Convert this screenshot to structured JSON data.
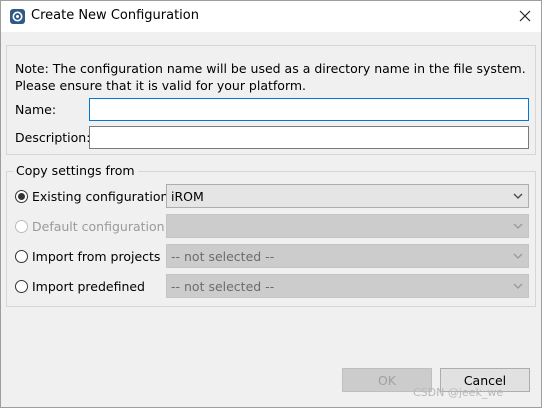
{
  "window": {
    "title": "Create New Configuration",
    "icon": "eclipse-app-icon",
    "close_icon": "close-icon"
  },
  "note": {
    "line1": "Note: The configuration name will be used as a directory name in the file system.",
    "line2": "Please ensure that it is valid for your platform."
  },
  "fields": {
    "name_label": "Name:",
    "name_value": "",
    "description_label": "Description:",
    "description_value": ""
  },
  "copy_settings": {
    "group_title": "Copy settings from",
    "options": [
      {
        "label": "Existing configuration",
        "checked": true,
        "enabled": true,
        "combo_value": "iROM",
        "combo_enabled": true
      },
      {
        "label": "Default configuration",
        "checked": false,
        "enabled": false,
        "combo_value": "",
        "combo_enabled": false
      },
      {
        "label": "Import from projects",
        "checked": false,
        "enabled": true,
        "combo_value": "-- not selected --",
        "combo_enabled": false
      },
      {
        "label": "Import predefined",
        "checked": false,
        "enabled": true,
        "combo_value": "-- not selected --",
        "combo_enabled": false
      }
    ]
  },
  "buttons": {
    "ok_label": "OK",
    "cancel_label": "Cancel"
  },
  "watermark": "CSDN @jeek_we"
}
